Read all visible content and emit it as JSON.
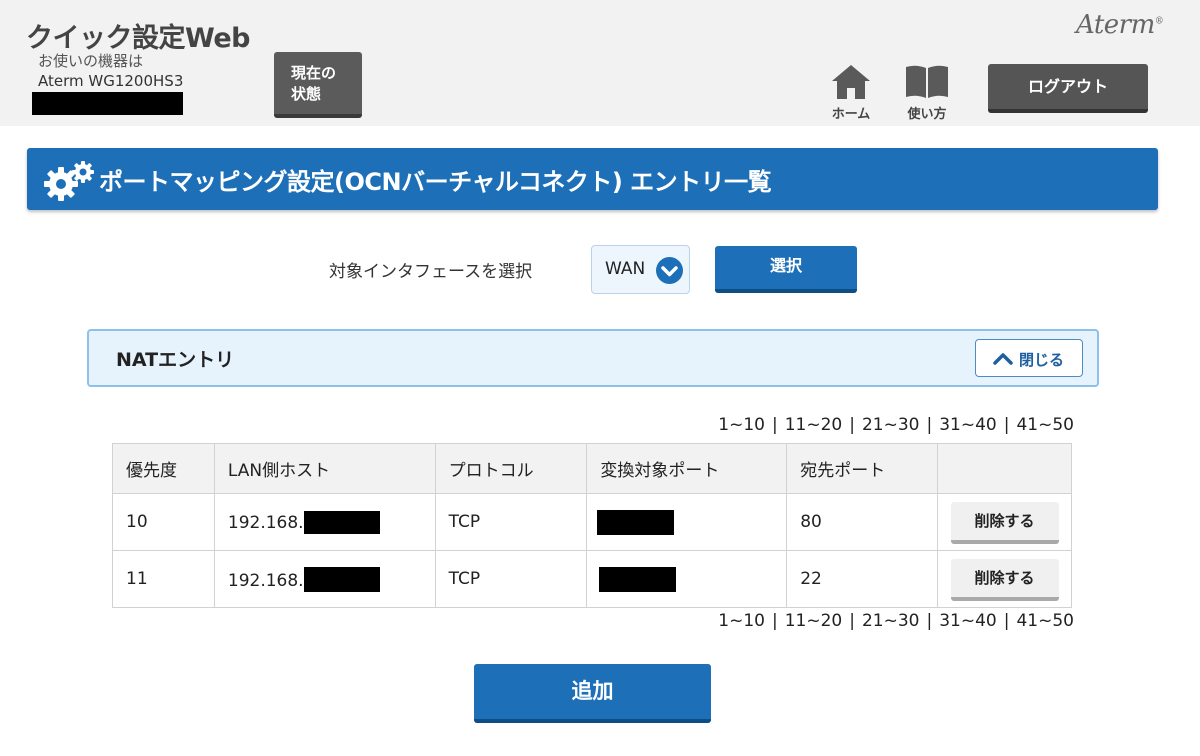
{
  "header": {
    "app_title": "クイック設定Web",
    "device_caption": "お使いの機器は",
    "device_model": "Aterm WG1200HS3",
    "status_button": {
      "line1": "現在の",
      "line2": "状態"
    },
    "brand": "Aterm",
    "brand_mark": "®",
    "nav": {
      "home_label": "ホーム",
      "help_label": "使い方"
    },
    "logout_label": "ログアウト"
  },
  "page_title": "ポートマッピング設定(OCNバーチャルコネクト) エントリ一覧",
  "interface_select": {
    "label": "対象インタフェースを選択",
    "value": "WAN",
    "button_label": "選択"
  },
  "nat_panel": {
    "title": "NATエントリ",
    "close_label": "閉じる"
  },
  "pagination": [
    "1~10",
    "11~20",
    "21~30",
    "31~40",
    "41~50"
  ],
  "table": {
    "headers": [
      "優先度",
      "LAN側ホスト",
      "プロトコル",
      "変換対象ポート",
      "宛先ポート",
      ""
    ],
    "rows": [
      {
        "priority": "10",
        "lan_host": "192.168.",
        "protocol": "TCP",
        "dest_port": "80",
        "delete_label": "削除する"
      },
      {
        "priority": "11",
        "lan_host": "192.168.",
        "protocol": "TCP",
        "dest_port": "22",
        "delete_label": "削除する"
      }
    ]
  },
  "add_button_label": "追加",
  "colors": {
    "accent_blue": "#1d6fb8",
    "header_bg": "#f2f2f2",
    "dark_button": "#555555",
    "panel_bg": "#e6f2fc"
  },
  "icons": [
    "gear-icon",
    "home-icon",
    "book-icon",
    "chevron-down-icon",
    "chevron-up-icon"
  ]
}
